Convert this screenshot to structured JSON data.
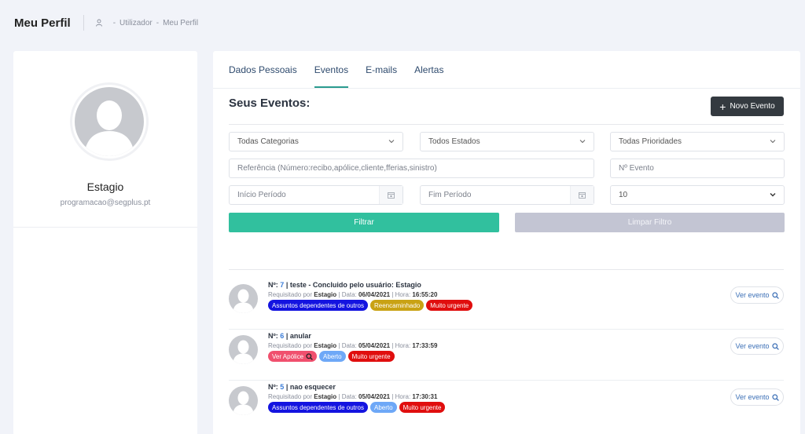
{
  "header": {
    "title": "Meu Perfil",
    "breadcrumb": [
      "Utilizador",
      "Meu Perfil"
    ],
    "separator": "-"
  },
  "profile": {
    "name": "Estagio",
    "email": "programacao@segplus.pt"
  },
  "tabs": [
    {
      "label": "Dados Pessoais",
      "active": false
    },
    {
      "label": "Eventos",
      "active": true
    },
    {
      "label": "E-mails",
      "active": false
    },
    {
      "label": "Alertas",
      "active": false
    }
  ],
  "events_section": {
    "title": "Seus Eventos:",
    "new_button": "Novo Evento"
  },
  "filters": {
    "category": "Todas Categorias",
    "state": "Todos Estados",
    "priority": "Todas Prioridades",
    "reference_placeholder": "Referência (Número:recibo,apólice,cliente,fferias,sinistro)",
    "event_number_placeholder": "Nº Evento",
    "start_placeholder": "Início Período",
    "end_placeholder": "Fim Período",
    "page_size": "10",
    "filter_button": "Filtrar",
    "clear_button": "Limpar Filtro"
  },
  "events": [
    {
      "prefix": "Nº: ",
      "number": "7",
      "title": " | teste - Concluido pelo usuário: Estagio",
      "requested_label": "Requisitado por ",
      "requester": "Estagio",
      "date_label": " | Data: ",
      "date": "06/04/2021",
      "time_label": " | Hora: ",
      "time": "16:55:20",
      "badges": [
        {
          "text": "Assuntos dependentes de outros",
          "color": "#1414e0"
        },
        {
          "text": "Reencaminhado",
          "color": "#c9a214"
        },
        {
          "text": "Muito urgente",
          "color": "#e00e0e"
        }
      ],
      "view_label": "Ver evento"
    },
    {
      "prefix": "Nº: ",
      "number": "6",
      "title": " | anular",
      "requested_label": "Requisitado por ",
      "requester": "Estagio",
      "date_label": " | Data: ",
      "date": "05/04/2021",
      "time_label": " | Hora: ",
      "time": "17:33:59",
      "badges": [
        {
          "text": "Ver Apólice",
          "color": "#f0506e",
          "icon": "search-icon"
        },
        {
          "text": "Aberto",
          "color": "#6ea8f7"
        },
        {
          "text": "Muito urgente",
          "color": "#e00e0e"
        }
      ],
      "view_label": "Ver evento"
    },
    {
      "prefix": "Nº: ",
      "number": "5",
      "title": " | nao esquecer",
      "requested_label": "Requisitado por ",
      "requester": "Estagio",
      "date_label": " | Data: ",
      "date": "05/04/2021",
      "time_label": " | Hora: ",
      "time": "17:30:31",
      "badges": [
        {
          "text": "Assuntos dependentes de outros",
          "color": "#1414e0"
        },
        {
          "text": "Aberto",
          "color": "#6ea8f7"
        },
        {
          "text": "Muito urgente",
          "color": "#e00e0e"
        }
      ],
      "view_label": "Ver evento"
    }
  ]
}
